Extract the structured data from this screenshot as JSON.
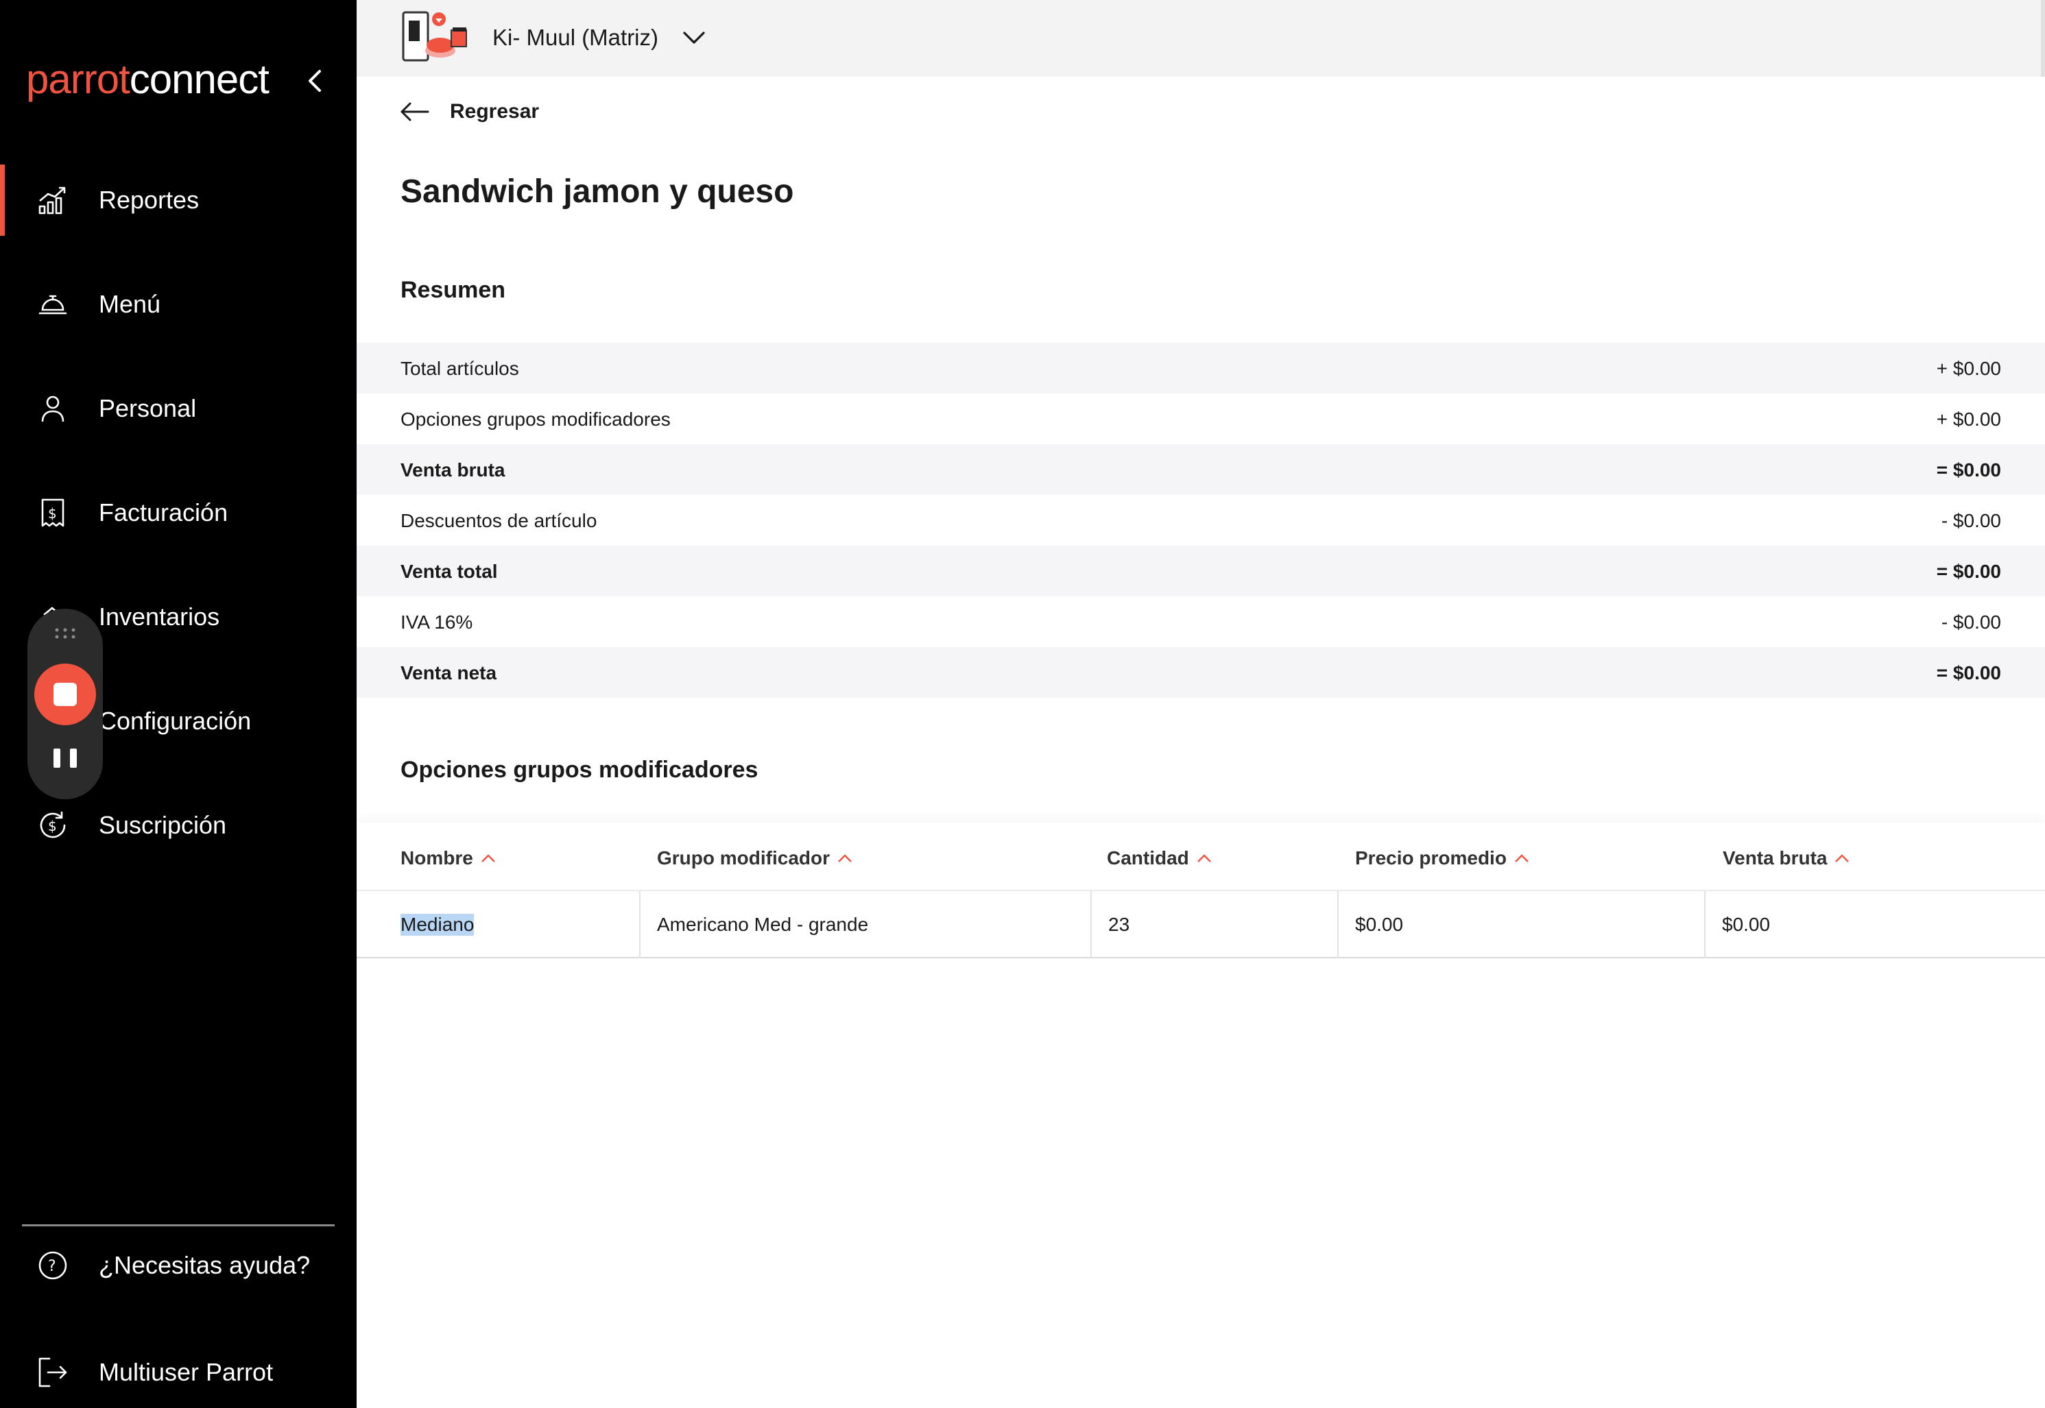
{
  "brand": {
    "part1": "parrot",
    "part2": "connect"
  },
  "colors": {
    "accent": "#f0533f",
    "sidebar_bg": "#000000",
    "topbar_bg": "#f3f3f4",
    "row_shade": "#f5f5f7",
    "selection": "#b9d6f5"
  },
  "sidebar": {
    "items": [
      {
        "label": "Reportes",
        "icon": "bar-chart-icon",
        "active": true
      },
      {
        "label": "Menú",
        "icon": "service-bell-icon"
      },
      {
        "label": "Personal",
        "icon": "user-icon"
      },
      {
        "label": "Facturación",
        "icon": "receipt-dollar-icon"
      },
      {
        "label": "Inventarios",
        "icon": "inventory-icon"
      },
      {
        "label": "Configuración",
        "icon": "settings-icon"
      },
      {
        "label": "Suscripción",
        "icon": "subscription-icon"
      }
    ],
    "help_label": "¿Necesitas ayuda?",
    "user_label": "Multiuser Parrot"
  },
  "topbar": {
    "store_name": "Ki- Muul (Matriz)"
  },
  "back_label": "Regresar",
  "page_title": "Sandwich jamon y queso",
  "summary": {
    "heading": "Resumen",
    "rows": [
      {
        "label": "Total artículos",
        "value": "+ $0.00"
      },
      {
        "label": "Opciones grupos modificadores",
        "value": "+ $0.00"
      },
      {
        "label": "Venta bruta",
        "value": "= $0.00"
      },
      {
        "label": "Descuentos de artículo",
        "value": "- $0.00"
      },
      {
        "label": "Venta total",
        "value": "= $0.00"
      },
      {
        "label": "IVA 16%",
        "value": "- $0.00"
      },
      {
        "label": "Venta neta",
        "value": "= $0.00"
      }
    ]
  },
  "modifiers": {
    "heading": "Opciones grupos modificadores",
    "columns": [
      "Nombre",
      "Grupo modificador",
      "Cantidad",
      "Precio promedio",
      "Venta bruta"
    ],
    "rows": [
      {
        "nombre": "Mediano",
        "grupo": "Americano Med - grande",
        "cantidad": "23",
        "precio": "$0.00",
        "venta": "$0.00"
      }
    ]
  }
}
